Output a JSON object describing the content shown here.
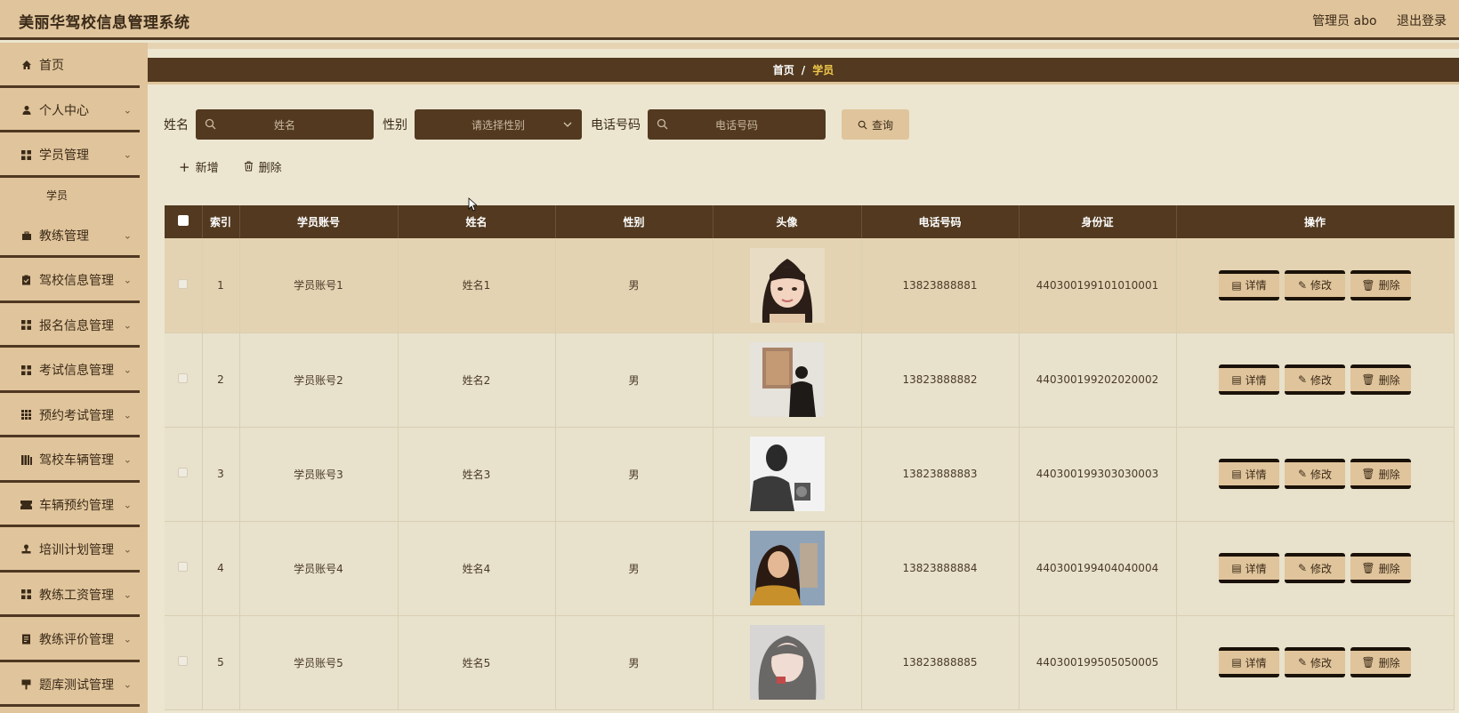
{
  "header": {
    "title": "美丽华驾校信息管理系统",
    "user": "管理员 abo",
    "logout": "退出登录"
  },
  "sidebar": {
    "items": [
      {
        "label": "首页",
        "icon": "home-icon",
        "has_children": false
      },
      {
        "label": "个人中心",
        "icon": "user-icon",
        "has_children": true
      },
      {
        "label": "学员管理",
        "icon": "grid-icon",
        "has_children": true,
        "children": [
          "学员"
        ]
      },
      {
        "label": "教练管理",
        "icon": "briefcase-icon",
        "has_children": true
      },
      {
        "label": "驾校信息管理",
        "icon": "clipboard-icon",
        "has_children": true
      },
      {
        "label": "报名信息管理",
        "icon": "grid-icon",
        "has_children": true
      },
      {
        "label": "考试信息管理",
        "icon": "grid-icon",
        "has_children": true
      },
      {
        "label": "预约考试管理",
        "icon": "apps-icon",
        "has_children": true
      },
      {
        "label": "驾校车辆管理",
        "icon": "bars-icon",
        "has_children": true
      },
      {
        "label": "车辆预约管理",
        "icon": "ticket-icon",
        "has_children": true
      },
      {
        "label": "培训计划管理",
        "icon": "stamp-icon",
        "has_children": true
      },
      {
        "label": "教练工资管理",
        "icon": "grid-icon",
        "has_children": true
      },
      {
        "label": "教练评价管理",
        "icon": "document-icon",
        "has_children": true
      },
      {
        "label": "题库测试管理",
        "icon": "sign-icon",
        "has_children": true
      }
    ]
  },
  "breadcrumb": {
    "home": "首页",
    "separator": "/",
    "current": "学员"
  },
  "search": {
    "name_label": "姓名",
    "name_placeholder": "姓名",
    "gender_label": "性别",
    "gender_placeholder": "请选择性别",
    "phone_label": "电话号码",
    "phone_placeholder": "电话号码",
    "query_button": "查询"
  },
  "actions": {
    "add": "新增",
    "delete": "删除"
  },
  "table": {
    "columns": [
      "索引",
      "学员账号",
      "姓名",
      "性别",
      "头像",
      "电话号码",
      "身份证",
      "操作"
    ],
    "rows": [
      {
        "index": "1",
        "account": "学员账号1",
        "name": "姓名1",
        "gender": "男",
        "phone": "13823888881",
        "id_card": "440300199101010001",
        "avatar": "avatar-girl-bob"
      },
      {
        "index": "2",
        "account": "学员账号2",
        "name": "姓名2",
        "gender": "男",
        "phone": "13823888882",
        "id_card": "440300199202020002",
        "avatar": "avatar-gallery"
      },
      {
        "index": "3",
        "account": "学员账号3",
        "name": "姓名3",
        "gender": "男",
        "phone": "13823888883",
        "id_card": "440300199303030003",
        "avatar": "avatar-man-bw"
      },
      {
        "index": "4",
        "account": "学员账号4",
        "name": "姓名4",
        "gender": "男",
        "phone": "13823888884",
        "id_card": "440300199404040004",
        "avatar": "avatar-girl-sunset"
      },
      {
        "index": "5",
        "account": "学员账号5",
        "name": "姓名5",
        "gender": "男",
        "phone": "13823888885",
        "id_card": "440300199505050005",
        "avatar": "avatar-girl-grey"
      }
    ],
    "op_buttons": {
      "detail": "详情",
      "edit": "修改",
      "delete": "删除"
    }
  },
  "colors": {
    "header_bg": "#e0c49b",
    "dark_brown": "#52391f",
    "page_bg": "#ece6d0",
    "accent_gold": "#f0c84a"
  }
}
